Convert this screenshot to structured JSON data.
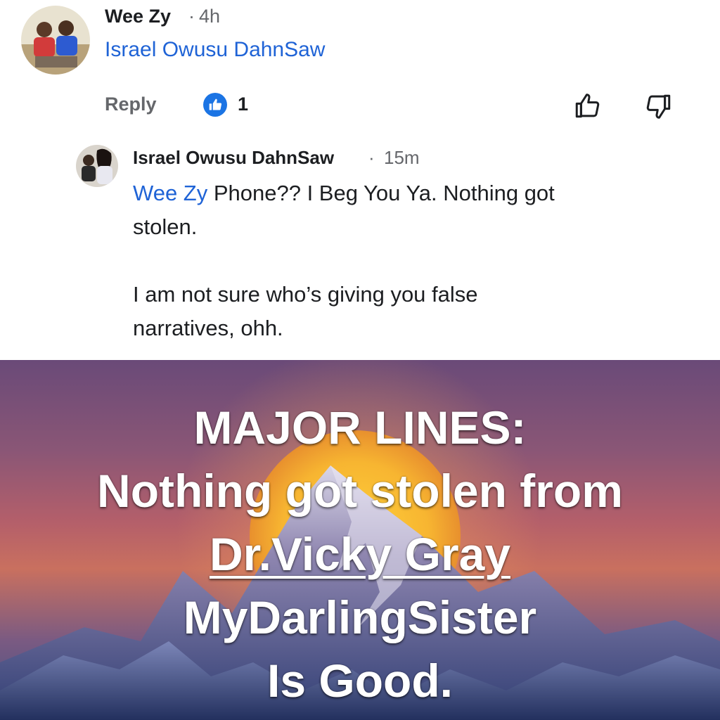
{
  "comment": {
    "author": "Wee Zy",
    "separator": "·",
    "time": "4h",
    "text": "Israel Owusu DahnSaw"
  },
  "actions": {
    "reply_label": "Reply",
    "like_count": "1"
  },
  "reply": {
    "author": "Israel Owusu DahnSaw",
    "separator": "·",
    "time": "15m",
    "mention": "Wee Zy",
    "line1": " Phone?? I Beg You Ya. Nothing got",
    "line2": "stolen.",
    "line3": "I am not sure who’s giving you false",
    "line4": "narratives, ohh."
  },
  "banner": {
    "line1": "MAJOR LINES:",
    "line2": "Nothing got stolen from",
    "line3": "Dr.Vicky Gray",
    "line4": "MyDarlingSister",
    "line5": "Is Good."
  },
  "colors": {
    "link": "#1f63d6",
    "like_badge": "#1b74e4",
    "secondary_text": "#65676b"
  },
  "icons": {
    "like_badge": "thumbs-up-icon",
    "like_button": "thumbs-up-outline-icon",
    "dislike_button": "thumbs-down-outline-icon"
  }
}
